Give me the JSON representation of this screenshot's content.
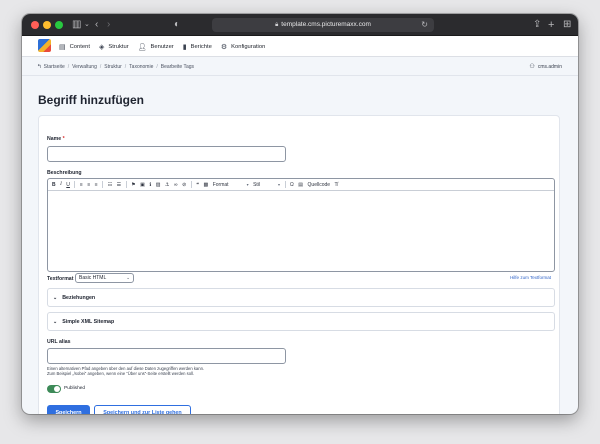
{
  "browser": {
    "url": "template.cms.picturemaxx.com"
  },
  "nav": {
    "items": [
      {
        "icon": "content-icon",
        "label": "Content"
      },
      {
        "icon": "structure-icon",
        "label": "Struktur"
      },
      {
        "icon": "users-icon",
        "label": "Benutzer"
      },
      {
        "icon": "reports-icon",
        "label": "Berichte"
      },
      {
        "icon": "config-icon",
        "label": "Konfiguration"
      }
    ]
  },
  "breadcrumb": [
    "Startseite",
    "Verwaltung",
    "Struktur",
    "Taxonomie",
    "Bearbeite Tags"
  ],
  "user": {
    "name": "cms.admin"
  },
  "page": {
    "title": "Begriff hinzufügen"
  },
  "form": {
    "name_label": "Name",
    "name_required": "*",
    "name_value": "",
    "description_label": "Beschreibung",
    "editor_toolbar": {
      "format_label": "Format",
      "style_label": "Stil",
      "source_label": "Quellcode"
    },
    "text_format_label": "Textformat",
    "text_format_value": "Basic HTML",
    "text_format_help": "Hilfe zum Textformat",
    "accordion_relations": "Beziehungen",
    "accordion_sitemap": "Simple XML Sitemap",
    "url_alias_label": "URL alias",
    "url_alias_value": "",
    "url_alias_desc_1": "Einen alternativen Pfad angeben über den auf diese Daten zugegriffen werden kann.",
    "url_alias_desc_2": "Zum Beispiel „/sobei“ angeben, wenn eine “Über uns”-Seite erstellt werden soll.",
    "published_label": "Published",
    "published": true,
    "save_label": "Speichern",
    "save_list_label": "Speichern und zur Liste gehen"
  },
  "colors": {
    "primary": "#2f6fe0",
    "toggle_on": "#3d8a58",
    "required": "#d62c2c"
  }
}
